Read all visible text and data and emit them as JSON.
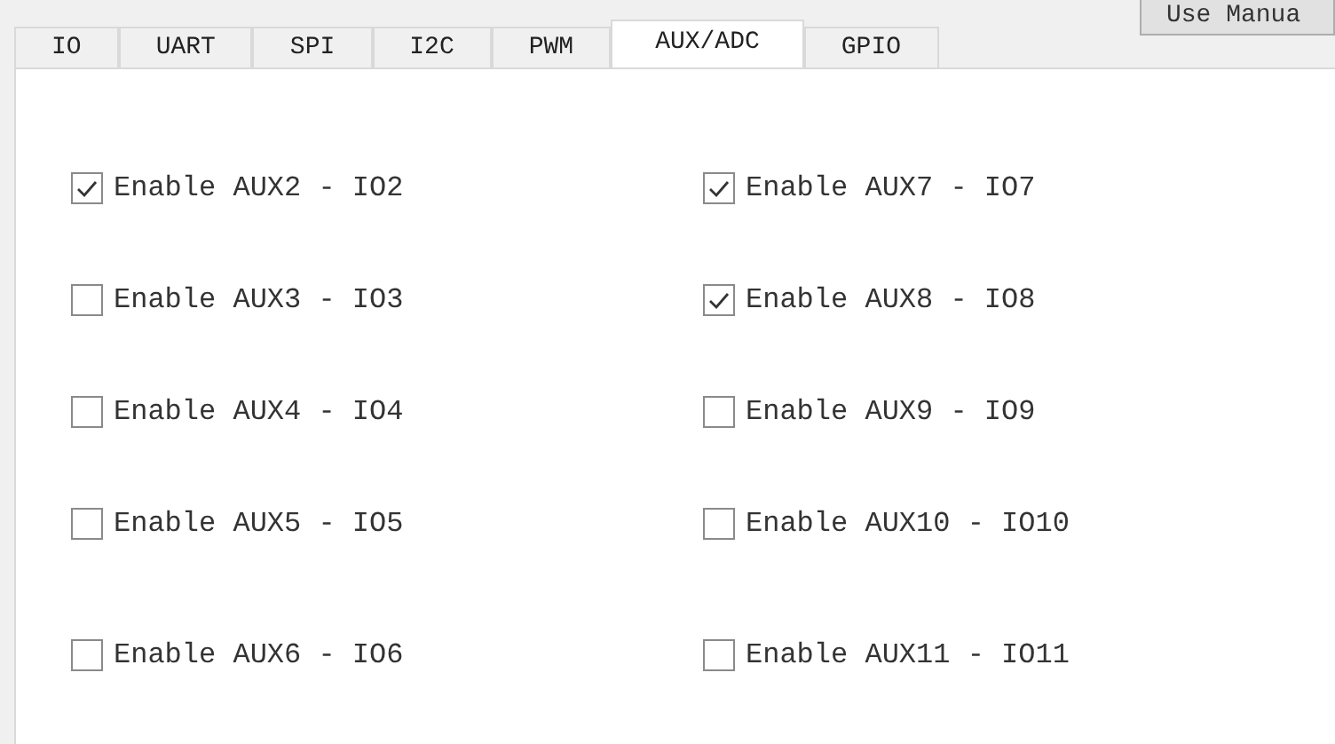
{
  "manual_button": "Use Manua",
  "tabs": [
    {
      "label": "IO",
      "selected": false
    },
    {
      "label": "UART",
      "selected": false
    },
    {
      "label": "SPI",
      "selected": false
    },
    {
      "label": "I2C",
      "selected": false
    },
    {
      "label": "PWM",
      "selected": false
    },
    {
      "label": "AUX/ADC",
      "selected": true
    },
    {
      "label": "GPIO",
      "selected": false
    }
  ],
  "columns": [
    [
      {
        "label": "Enable AUX2 - IO2",
        "checked": true
      },
      {
        "label": "Enable AUX3 - IO3",
        "checked": false
      },
      {
        "label": "Enable AUX4 - IO4",
        "checked": false
      },
      {
        "label": "Enable AUX5 - IO5",
        "checked": false
      },
      {
        "label": "Enable AUX6 - IO6",
        "checked": false
      }
    ],
    [
      {
        "label": "Enable AUX7 - IO7",
        "checked": true
      },
      {
        "label": "Enable AUX8 - IO8",
        "checked": true
      },
      {
        "label": "Enable AUX9 - IO9",
        "checked": false
      },
      {
        "label": "Enable AUX10 - IO10",
        "checked": false
      },
      {
        "label": "Enable AUX11 - IO11",
        "checked": false
      }
    ]
  ]
}
